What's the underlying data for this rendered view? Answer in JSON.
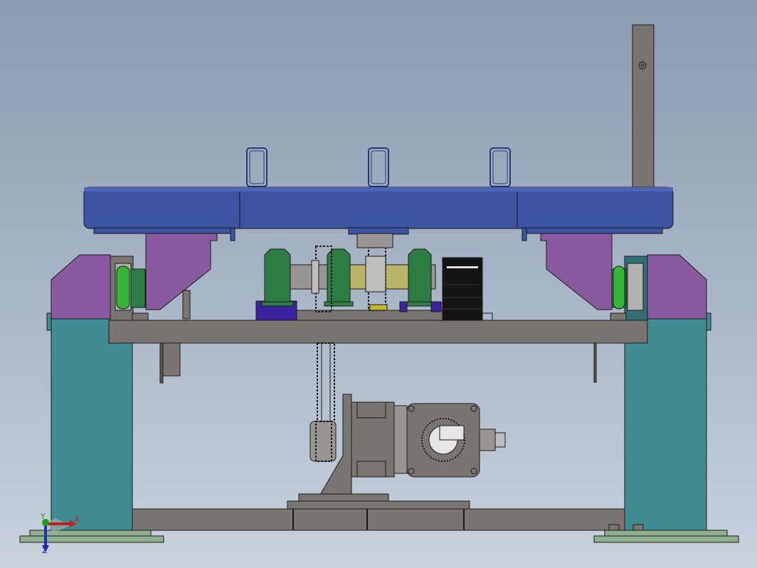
{
  "viewport": {
    "name": "solidworks-graphics-area",
    "background_top": "#8b9bb0",
    "background_bottom": "#c9d2dd"
  },
  "colors": {
    "frame_gray": "#7a7570",
    "frame_gray_dark": "#5c5752",
    "beam_blue": "#3b53a0",
    "beam_blue_dark": "#263a7a",
    "purple": "#8a5a9e",
    "teal": "#3f8c93",
    "teal_dark": "#2f6f75",
    "green_bearing": "#2e7d44",
    "green_wheel": "#36b636",
    "olive_shaft": "#b8b56a",
    "indigo_block": "#3c22a0",
    "black_box": "#141414",
    "base_plate_green": "#8fb08f",
    "outline": "#1a1a1a"
  },
  "triad": {
    "x_label": "X",
    "y_label": "Y",
    "z_label": "Z",
    "x_color": "#c0201e",
    "y_color": "#19a019",
    "z_color": "#1a2fbf"
  },
  "parts": {
    "top_beam": "conveyor-top-beam",
    "lifting_lugs": 3,
    "motor": "gear-motor",
    "chain": "drive-chain",
    "bearings": 3,
    "guide_wheels": 2
  }
}
